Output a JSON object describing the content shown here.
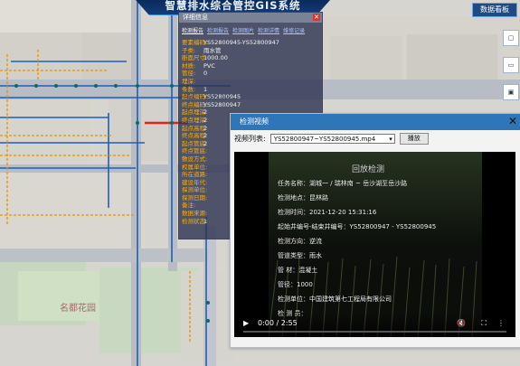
{
  "header": {
    "title": "智慧排水综合管控GIS系统",
    "screen_button": "数据看板"
  },
  "map_labels": {
    "garden": "名都花园"
  },
  "detail": {
    "title": "详细信息",
    "tabs": [
      "检测报告",
      "检测报告",
      "检测图片",
      "检测详情",
      "维修记录"
    ],
    "rows": [
      {
        "k": "要素编码:",
        "v": "YS52800945-YS52800947"
      },
      {
        "k": "子类:",
        "v": "雨水管"
      },
      {
        "k": "断面尺寸:",
        "v": "1000.00"
      },
      {
        "k": "材质:",
        "v": "PVC"
      },
      {
        "k": "管径:",
        "v": "0"
      },
      {
        "k": "埋深:",
        "v": ""
      },
      {
        "k": "条数:",
        "v": "1"
      },
      {
        "k": "起点编码:",
        "v": "YS52800945"
      },
      {
        "k": "终点编码:",
        "v": "YS52800947"
      },
      {
        "k": "起点埋深:",
        "v": "2"
      },
      {
        "k": "终点埋深:",
        "v": "2"
      },
      {
        "k": "起点高程:",
        "v": "2"
      },
      {
        "k": "终点高程:",
        "v": "2"
      },
      {
        "k": "起点管底:",
        "v": "2"
      },
      {
        "k": "终点管底:",
        "v": ""
      },
      {
        "k": "敷设方式:",
        "v": ""
      },
      {
        "k": "权属单位:",
        "v": ""
      },
      {
        "k": "所在道路:",
        "v": ""
      },
      {
        "k": "建设年代:",
        "v": ""
      },
      {
        "k": "探测单位:",
        "v": ""
      },
      {
        "k": "探测日期:",
        "v": ""
      },
      {
        "k": "备注:",
        "v": ""
      },
      {
        "k": "数据来源:",
        "v": ""
      },
      {
        "k": "检测状态:",
        "v": "1"
      }
    ]
  },
  "video": {
    "window_title": "检测视频",
    "list_label": "视频列表:",
    "selected_file": "YS52800947~YS52800945.mp4",
    "play_button": "播放",
    "close_symbol": "✕",
    "overlay": {
      "title": "回放检测",
      "line1": "任务名称：湖城一 / 瑞林南 ~ 岳沙湖至岳沙路",
      "line2": "检测地点：昆林路",
      "line3": "检测时间：2021-12-20 15:31:16",
      "line4": "起始井编号-结束井编号：YS52800947 - YS52800945",
      "line5": "检测方向：逆流",
      "line6": "管道类型：雨水",
      "line7": "管    材：混凝土",
      "line8": "管径：1000",
      "line9": "检测单位：中国建筑第七工程局有限公司",
      "line10": "检 测 员：",
      "time": "0:00 / 2:55",
      "progress": 0.0
    }
  }
}
